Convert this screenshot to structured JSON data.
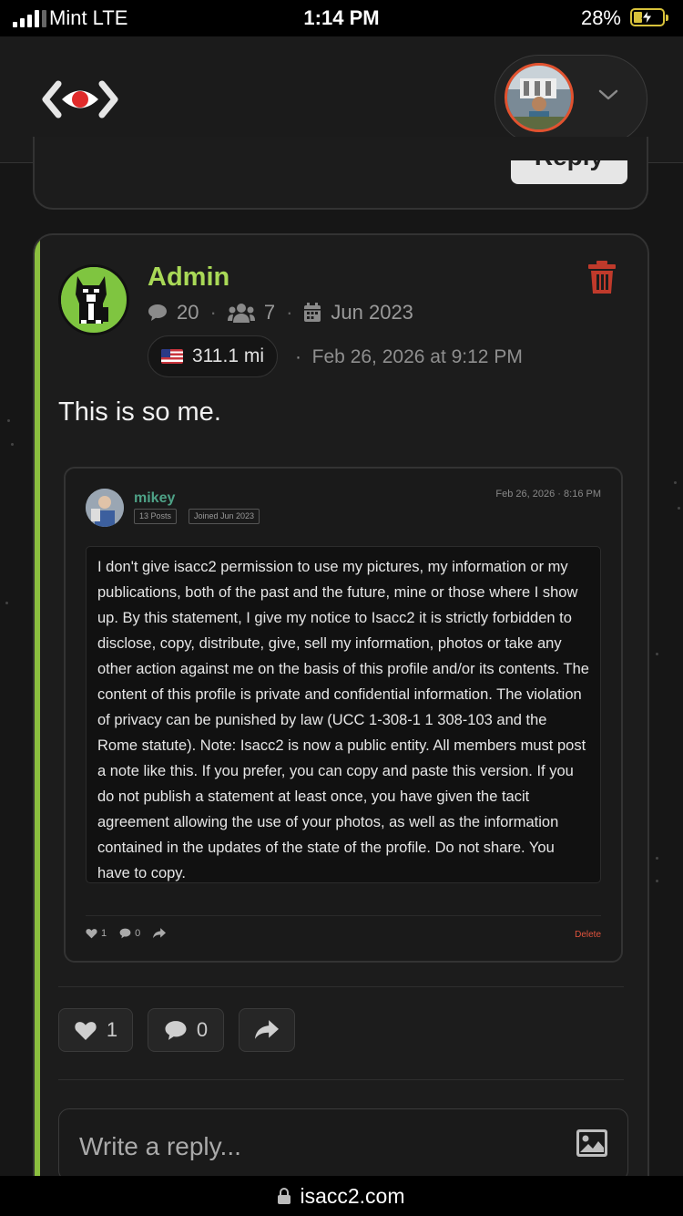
{
  "status_bar": {
    "carrier": "Mint  LTE",
    "time": "1:14 PM",
    "battery_pct": "28%"
  },
  "header": {
    "logo_icon": "eye-logo-icon",
    "account_menu_icon": "chevron-down-icon"
  },
  "previous_post": {
    "reply_label": "Reply"
  },
  "comment": {
    "author": "Admin",
    "accent_color": "#8bbf3f",
    "stats": {
      "posts": "20",
      "friends": "7",
      "joined": "Jun 2023"
    },
    "distance": "311.1 mi",
    "separator": "·",
    "timestamp": "Feb 26, 2026 at 9:12 PM",
    "text": "This is so me.",
    "delete_icon": "trash-icon",
    "likes": "1",
    "replies": "0"
  },
  "quoted": {
    "author": "mikey",
    "posts_badge": "13 Posts",
    "joined_badge": "Joined Jun 2023",
    "date": "Feb 26, 2026 · 8:16 PM",
    "body": "I don't give isacc2 permission to use my pictures, my information or my publications, both of the past and the future, mine or those where I show up. By this statement, I give my notice to Isacc2 it is strictly forbidden to disclose, copy, distribute, give, sell my information, photos or take any other action against me on the basis of this profile and/or its contents. The content of this profile is private and confidential information. The violation of privacy can be punished by law (UCC 1-308-1 1 308-103 and the Rome statute). Note: Isacc2 is now a public entity. All members must post a note like this. If you prefer, you can copy and paste this version. If you do not publish a statement at least once, you have given the tacit agreement allowing the use of your photos, as well as the information contained in the updates of the state of the profile. Do not share. You have to copy.",
    "likes": "1",
    "replies": "0",
    "delete_label": "Delete"
  },
  "reply_box": {
    "placeholder": "Write a reply..."
  },
  "url_bar": {
    "domain": "isacc2.com"
  }
}
